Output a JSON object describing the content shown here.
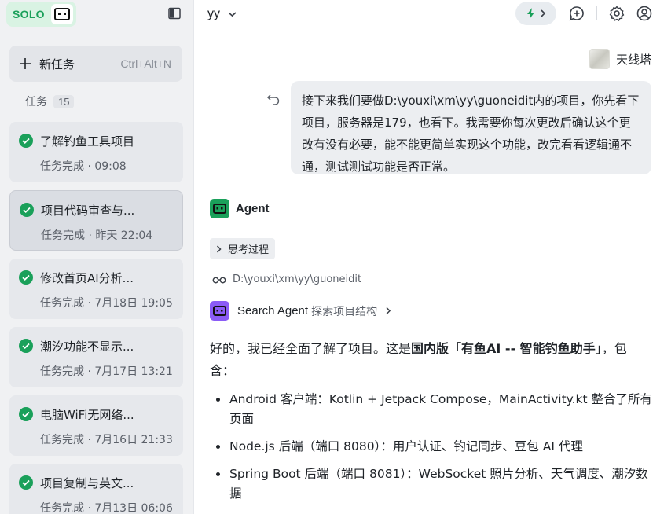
{
  "sidebar": {
    "brand": "SOLO",
    "new_task": {
      "label": "新任务",
      "shortcut": "Ctrl+Alt+N"
    },
    "tasks_header": {
      "label": "任务",
      "count": "15"
    },
    "tasks": [
      {
        "title": "了解钓鱼工具项目",
        "meta": "任务完成 · 09:08"
      },
      {
        "title": "项目代码审查与...",
        "meta": "任务完成 · 昨天 22:04"
      },
      {
        "title": "修改首页AI分析...",
        "meta": "任务完成 · 7月18日 19:05"
      },
      {
        "title": "潮汐功能不显示...",
        "meta": "任务完成 · 7月17日 13:21"
      },
      {
        "title": "电脑WiFi无网络...",
        "meta": "任务完成 · 7月16日 21:33"
      },
      {
        "title": "项目复制与英文...",
        "meta": "任务完成 · 7月13日 06:06"
      }
    ]
  },
  "topbar": {
    "workspace": "yy"
  },
  "conversation": {
    "user": {
      "name": "天线塔",
      "message": "接下来我们要做D:\\youxi\\xm\\yy\\guoneidit内的项目，你先看下项目，服务器是179，也看下。我需要你每次更改后确认这个更改有没有必要，能不能更简单实现这个功能，改完看看逻辑通不通，测试测试功能是否正常。"
    },
    "agent": {
      "name": "Agent",
      "thinking_label": "思考过程",
      "path": "D:\\youxi\\xm\\yy\\guoneidit",
      "search_agent": {
        "label": "Search Agent",
        "desc": "探索项目结构"
      },
      "reply_pre": "好的，我已经全面了解了项目。这是",
      "reply_bold": "国内版「有鱼AI -- 智能钓鱼助手」",
      "reply_post": "，包含：",
      "bullets": [
        "Android 客户端：Kotlin + Jetpack Compose，MainActivity.kt 整合了所有页面",
        "Node.js 后端（端口 8080）：用户认证、钓记同步、豆包 AI 代理",
        "Spring Boot 后端（端口 8081）：WebSocket 照片分析、天气调度、潮汐数据"
      ]
    }
  },
  "colors": {
    "accent_green": "#1aa05a",
    "search_agent_purple": "#8b5cf6"
  },
  "icons": [
    "robot-logo-icon",
    "panel-toggle-icon",
    "plus-icon",
    "check-circle-icon",
    "chevron-down-icon",
    "lightning-icon",
    "chevron-right-icon",
    "chat-add-icon",
    "gear-icon",
    "user-circle-icon",
    "undo-icon",
    "glasses-icon"
  ]
}
